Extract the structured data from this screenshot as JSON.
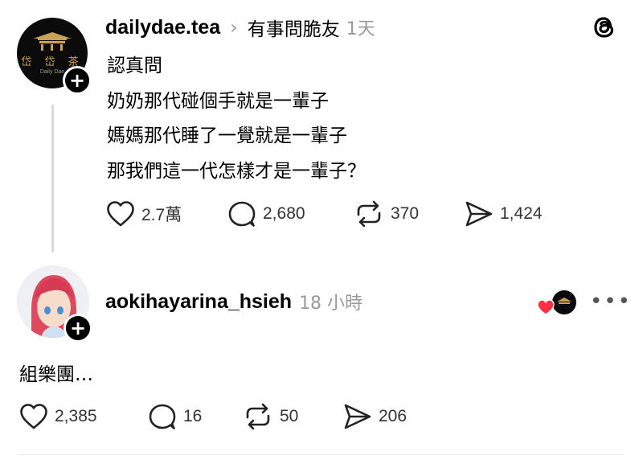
{
  "post": {
    "username": "dailydae.tea",
    "chevron": "›",
    "community": "有事問脆友",
    "time": "1天",
    "avatar_text": "岱 岱 茶",
    "avatar_sub": "Daily Dae",
    "lines": [
      "認真問",
      "奶奶那代碰個手就是一輩子",
      "媽媽那代睡了一覺就是一輩子",
      "那我們這一代怎樣才是一輩子？"
    ],
    "actions": {
      "like_count": "2.7萬",
      "comment_count": "2,680",
      "repost_count": "370",
      "share_count": "1,424"
    }
  },
  "reply": {
    "username": "aokihayarina_hsieh",
    "time": "18 小時",
    "text": "組樂團…",
    "more": "•••",
    "actions": {
      "like_count": "2,385",
      "comment_count": "16",
      "repost_count": "50",
      "share_count": "206"
    }
  },
  "icons": {
    "app_logo": "threads-logo-icon",
    "like": "heart-icon",
    "comment": "comment-bubble-icon",
    "repost": "repost-arrows-icon",
    "share": "send-icon",
    "follow": "plus-icon",
    "liked_by_author": "red-heart-icon"
  },
  "colors": {
    "text": "#000000",
    "secondary": "#999999",
    "heart_red": "#ff3040",
    "thread_line": "#d9d9d9"
  }
}
